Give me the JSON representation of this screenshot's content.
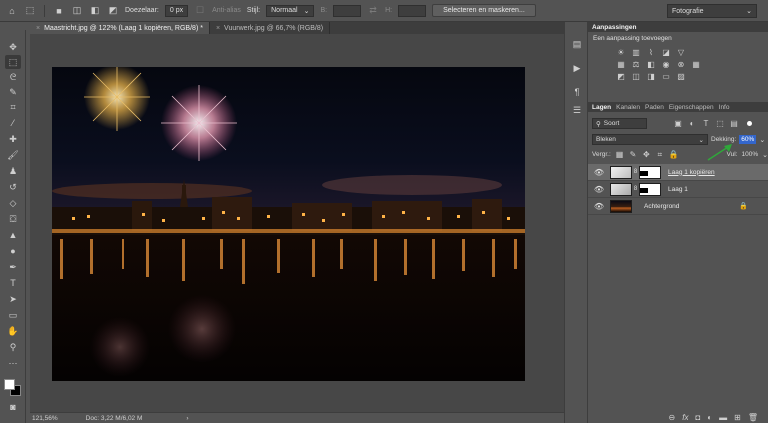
{
  "options_bar": {
    "feather_label": "Doezelaar:",
    "feather_value": "0 px",
    "antialias_label": "Anti-alias",
    "style_label": "Stijl:",
    "style_value": "Normaal",
    "width_label": "B:",
    "height_label": "H:",
    "select_mask_button": "Selecteren en maskeren...",
    "workspace": "Fotografie"
  },
  "tabs": [
    {
      "label": "Maastricht.jpg @ 122% (Laag 1 kopiëren, RGB/8) *",
      "close": "×"
    },
    {
      "label": "Vuurwerk.jpg @ 66,7% (RGB/8)",
      "close": "×"
    }
  ],
  "status": {
    "zoom": "121,56%",
    "doc": "Doc: 3,22 M/6,02 M",
    "arrow": "›"
  },
  "adjustments": {
    "title": "Aanpassingen",
    "subtitle": "Een aanpassing toevoegen"
  },
  "layers_panel": {
    "tabs": [
      "Lagen",
      "Kanalen",
      "Paden",
      "Eigenschappen",
      "Info"
    ],
    "kind_label": "Soort",
    "blend_mode": "Bleken",
    "opacity_label": "Dekking:",
    "opacity_value": "60%",
    "lock_label": "Vergr.:",
    "fill_label": "Vul:",
    "fill_value": "100%",
    "layers": [
      {
        "name": "Laag 1 kopiëren",
        "visible": true,
        "active": true
      },
      {
        "name": "Laag 1",
        "visible": true,
        "active": false
      },
      {
        "name": "Achtergrond",
        "visible": true,
        "active": false
      }
    ]
  },
  "colors": {
    "accent": "#3366cc",
    "arrow": "#2fa83a"
  }
}
